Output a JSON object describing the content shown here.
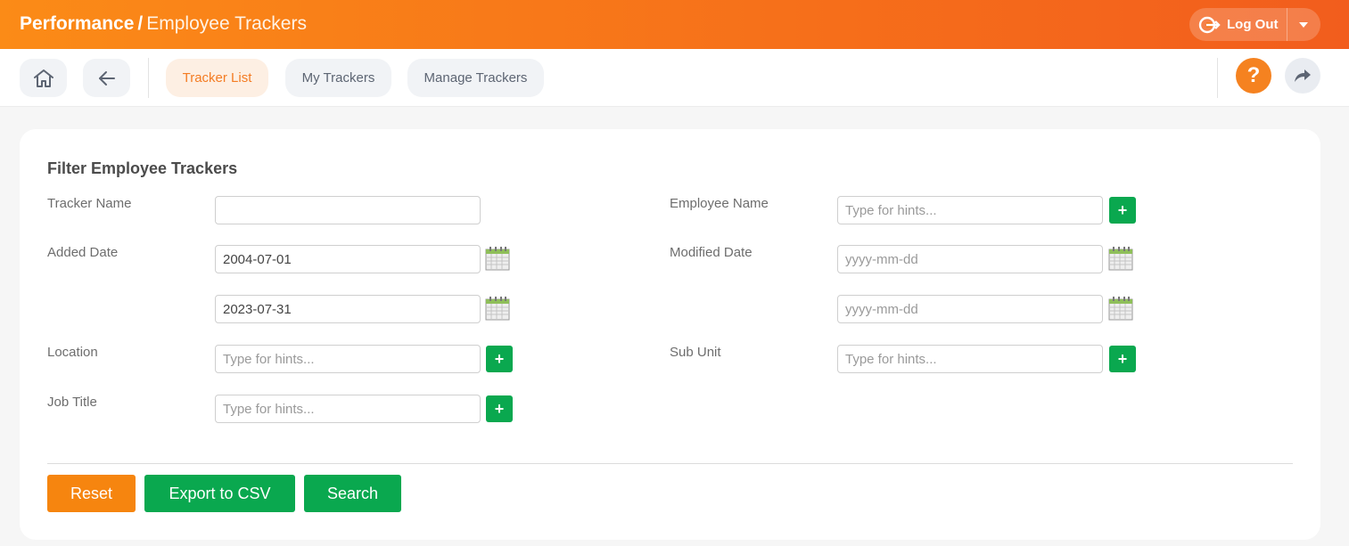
{
  "header": {
    "module": "Performance",
    "separator": "/",
    "page": "Employee Trackers",
    "logout_label": "Log Out"
  },
  "nav": {
    "tabs": [
      {
        "label": "Tracker List",
        "active": true
      },
      {
        "label": "My Trackers",
        "active": false
      },
      {
        "label": "Manage Trackers",
        "active": false
      }
    ],
    "help_label": "?"
  },
  "filter": {
    "title": "Filter Employee Trackers",
    "tracker_name": {
      "label": "Tracker Name",
      "value": "",
      "placeholder": ""
    },
    "employee_name": {
      "label": "Employee Name",
      "value": "",
      "placeholder": "Type for hints..."
    },
    "added_date": {
      "label": "Added Date",
      "from": "2004-07-01",
      "to": "2023-07-31"
    },
    "modified_date": {
      "label": "Modified Date",
      "from_placeholder": "yyyy-mm-dd",
      "to_placeholder": "yyyy-mm-dd"
    },
    "location": {
      "label": "Location",
      "placeholder": "Type for hints..."
    },
    "sub_unit": {
      "label": "Sub Unit",
      "placeholder": "Type for hints..."
    },
    "job_title": {
      "label": "Job Title",
      "placeholder": "Type for hints..."
    },
    "plus_label": "+"
  },
  "actions": {
    "reset": "Reset",
    "export": "Export to CSV",
    "search": "Search"
  },
  "colors": {
    "brand_orange": "#f58220",
    "success_green": "#0aa84f"
  },
  "icons": [
    "home-icon",
    "back-arrow-icon",
    "logout-icon",
    "chevron-down-icon",
    "help-icon",
    "share-icon",
    "calendar-icon",
    "plus-icon"
  ]
}
